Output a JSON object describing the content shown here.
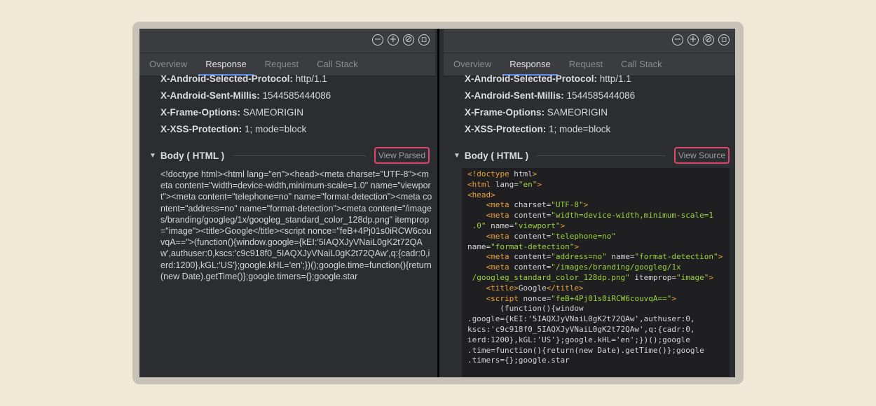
{
  "tabs": [
    "Overview",
    "Response",
    "Request",
    "Call Stack"
  ],
  "active_tab": "Response",
  "toolbar_icons": [
    "zoom-out-icon",
    "zoom-in-icon",
    "reset-zoom-icon",
    "fit-icon"
  ],
  "headers": [
    {
      "key": "X-Android-Selected-Protocol:",
      "value": "http/1.1"
    },
    {
      "key": "X-Android-Sent-Millis:",
      "value": "1544585444086"
    },
    {
      "key": "X-Frame-Options:",
      "value": "SAMEORIGIN"
    },
    {
      "key": "X-XSS-Protection:",
      "value": "1; mode=block"
    }
  ],
  "body_title": "Body ( HTML )",
  "left": {
    "view_button": "View Parsed",
    "raw_body": "<!doctype html><html lang=\"en\"><head><meta charset=\"UTF-8\"><meta content=\"width=device-width,minimum-scale=1.0\" name=\"viewport\"><meta content=\"telephone=no\" name=\"format-detection\"><meta content=\"address=no\" name=\"format-detection\"><meta content=\"/images/branding/googleg/1x/googleg_standard_color_128dp.png\" itemprop=\"image\"><title>Google</title><script nonce=\"feB+4Pj01s0iRCW6couvqA==\">(function(){window.google={kEI:'5IAQXJyVNaiL0gK2t72QAw',authuser:0,kscs:'c9c918f0_5IAQXJyVNaiL0gK2t72QAw',q:{cadr:0,ierd:1200},kGL:'US'};google.kHL='en';})();google.time=function(){return(new Date).getTime()};google.timers={};google.star"
  },
  "right": {
    "view_button": "View Source",
    "code_lines": [
      [
        [
          "t",
          "<!doctype "
        ],
        [
          "a",
          "html"
        ],
        [
          "t",
          ">"
        ]
      ],
      [
        [
          "t",
          "<html "
        ],
        [
          "a",
          "lang="
        ],
        [
          "v",
          "\"en\""
        ],
        [
          "t",
          ">"
        ]
      ],
      [
        [
          "t",
          "<head>"
        ]
      ],
      [
        [
          "a",
          "    "
        ],
        [
          "t",
          "<meta "
        ],
        [
          "a",
          "charset="
        ],
        [
          "v",
          "\"UTF-8\""
        ],
        [
          "t",
          ">"
        ]
      ],
      [
        [
          "a",
          "    "
        ],
        [
          "t",
          "<meta "
        ],
        [
          "a",
          "content="
        ],
        [
          "v",
          "\"width=device-width,minimum-scale=1"
        ]
      ],
      [
        [
          "v",
          " .0\""
        ],
        [
          "a",
          " name="
        ],
        [
          "v",
          "\"viewport\""
        ],
        [
          "t",
          ">"
        ]
      ],
      [
        [
          "a",
          "    "
        ],
        [
          "t",
          "<meta "
        ],
        [
          "a",
          "content="
        ],
        [
          "v",
          "\"telephone=no\""
        ]
      ],
      [
        [
          "a",
          "name="
        ],
        [
          "v",
          "\"format-detection\""
        ],
        [
          "t",
          ">"
        ]
      ],
      [
        [
          "a",
          "    "
        ],
        [
          "t",
          "<meta "
        ],
        [
          "a",
          "content="
        ],
        [
          "v",
          "\"address=no\""
        ],
        [
          "a",
          " name="
        ],
        [
          "v",
          "\"format-detection\""
        ],
        [
          "t",
          ">"
        ]
      ],
      [
        [
          "a",
          "    "
        ],
        [
          "t",
          "<meta "
        ],
        [
          "a",
          "content="
        ],
        [
          "v",
          "\"/images/branding/googleg/1x"
        ]
      ],
      [
        [
          "v",
          " /googleg_standard_color_128dp.png\""
        ],
        [
          "a",
          " itemprop="
        ],
        [
          "v",
          "\"image\""
        ],
        [
          "t",
          ">"
        ]
      ],
      [
        [
          "a",
          "    "
        ],
        [
          "t",
          "<title>"
        ],
        [
          "a",
          "Google"
        ],
        [
          "t",
          "</title>"
        ]
      ],
      [
        [
          "a",
          "    "
        ],
        [
          "t",
          "<script "
        ],
        [
          "a",
          "nonce="
        ],
        [
          "v",
          "\"feB+4Pj01s0iRCW6couvqA==\""
        ],
        [
          "t",
          ">"
        ]
      ],
      [
        [
          "a",
          "       (function(){window"
        ]
      ],
      [
        [
          "a",
          ".google={kEI:'5IAQXJyVNaiL0gK2t72QAw',authuser:0,"
        ]
      ],
      [
        [
          "a",
          "kscs:'c9c918f0_5IAQXJyVNaiL0gK2t72QAw',q:{cadr:0,"
        ]
      ],
      [
        [
          "a",
          "ierd:1200},kGL:'US'};google.kHL='en';})();google"
        ]
      ],
      [
        [
          "a",
          ".time=function(){return(new Date).getTime()};google"
        ]
      ],
      [
        [
          "a",
          ".timers={};google.star"
        ]
      ]
    ]
  }
}
